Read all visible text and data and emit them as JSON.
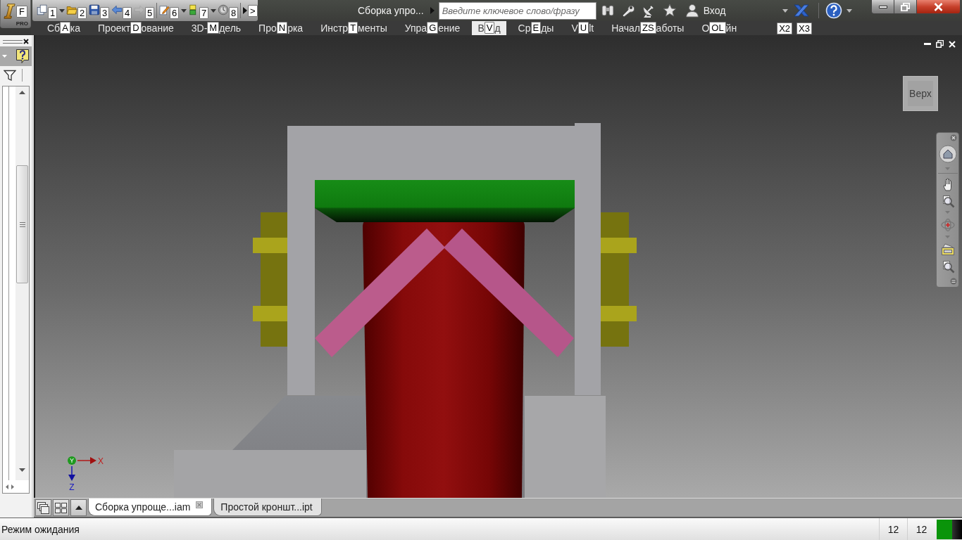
{
  "app_button": {
    "keytip": "F",
    "edition": "PRO"
  },
  "quick_access": [
    {
      "kind": "new",
      "keytip": "1",
      "dropdown": true,
      "disabled": false
    },
    {
      "kind": "open",
      "keytip": "2",
      "dropdown": false,
      "disabled": false
    },
    {
      "kind": "save",
      "keytip": "3",
      "dropdown": false,
      "disabled": false
    },
    {
      "kind": "undo",
      "keytip": "4",
      "dropdown": false,
      "disabled": false
    },
    {
      "kind": "redo",
      "keytip": "5",
      "dropdown": false,
      "disabled": true
    },
    {
      "kind": "project",
      "keytip": "6",
      "dropdown": true,
      "disabled": false
    },
    {
      "kind": "material",
      "keytip": "7",
      "dropdown": true,
      "disabled": false
    },
    {
      "kind": "appearance",
      "keytip": "8",
      "dropdown": false,
      "disabled": false
    },
    {
      "kind": "more",
      "keytip": ">",
      "dropdown": false,
      "disabled": false
    }
  ],
  "title": "Сборка упро...",
  "search": {
    "placeholder": "Введите ключевое слово/фразу"
  },
  "sign_in": "Вход",
  "ribbon_tabs": [
    {
      "before": "Сб",
      "keytip": "A",
      "after": "ка",
      "selected": false
    },
    {
      "before": "Проект",
      "keytip": "D",
      "after": "ование",
      "selected": false
    },
    {
      "before": "3D-",
      "keytip": "M",
      "after": "дель",
      "selected": false
    },
    {
      "before": "Про",
      "keytip": "N",
      "after": "рка",
      "selected": false
    },
    {
      "before": "Инстр",
      "keytip": "T",
      "after": "менты",
      "selected": false
    },
    {
      "before": "Упра",
      "keytip": "G",
      "after": "ение",
      "selected": false
    },
    {
      "before": "В",
      "keytip": "V",
      "after": "д",
      "selected": true
    },
    {
      "before": "Ср",
      "keytip": "E",
      "after": "ды",
      "selected": false
    },
    {
      "before": "V",
      "keytip": "U",
      "after": "lt",
      "selected": false
    },
    {
      "before": "Начал",
      "keytip": "ZS",
      "after": "аботы",
      "selected": false
    },
    {
      "before": "О",
      "keytip": "OL",
      "after": "йн",
      "selected": false
    }
  ],
  "extra_keytips": [
    "X2",
    "X3"
  ],
  "viewport": {
    "view_cube": "Верх",
    "axes": {
      "x": "X",
      "y": "Y",
      "z": "Z"
    }
  },
  "document_tabs": [
    {
      "label": "Сборка упроще...iam",
      "selected": true
    },
    {
      "label": "Простой кроншт...ipt",
      "selected": false
    }
  ],
  "status_bar": {
    "message": "Режим ожидания",
    "counts": [
      "12",
      "12"
    ]
  }
}
